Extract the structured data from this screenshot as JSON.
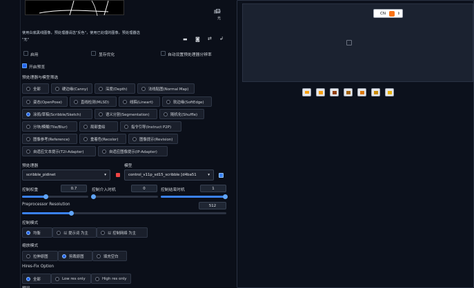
{
  "preview": {
    "buttons": [
      "翻转",
      "光"
    ]
  },
  "hint": {
    "line1": "使用白底黑线图像，预处理器请选\"反色\"，使用已处理的图像，预处理器选",
    "line2": "\"无\""
  },
  "checkboxes": [
    {
      "label": "启用",
      "checked": false
    },
    {
      "label": "显存优化",
      "checked": false
    },
    {
      "label": "自动设置预处理器分辨率",
      "checked": false
    },
    {
      "label": "开启预览",
      "checked": true
    }
  ],
  "filter": {
    "title": "预处理器与模型筛选",
    "items": [
      {
        "label": "全部",
        "selected": false
      },
      {
        "label": "硬边缘(Canny)",
        "selected": false
      },
      {
        "label": "深度(Depth)",
        "selected": false
      },
      {
        "label": "法线贴图(Normal Map)",
        "selected": false
      },
      {
        "label": "姿态(OpenPose)",
        "selected": false
      },
      {
        "label": "直线检测(MLSD)",
        "selected": false
      },
      {
        "label": "线稿(Lineart)",
        "selected": false
      },
      {
        "label": "软边缘(SoftEdge)",
        "selected": false
      },
      {
        "label": "涂鸦/草稿(Scribble/Sketch)",
        "selected": true
      },
      {
        "label": "语义分割(Segmentation)",
        "selected": false
      },
      {
        "label": "随机化(Shuffle)",
        "selected": false
      },
      {
        "label": "分块/模糊(Tile/Blur)",
        "selected": false
      },
      {
        "label": "局部重绘",
        "selected": false
      },
      {
        "label": "指令引导(Instruct P2P)",
        "selected": false
      },
      {
        "label": "图像参考(Reference)",
        "selected": false
      },
      {
        "label": "重着色(Recolor)",
        "selected": false
      },
      {
        "label": "图像提示(Revision)",
        "selected": false
      },
      {
        "label": "自适应文本提示(T2I-Adapter)",
        "selected": false
      },
      {
        "label": "自适应图像提示(IP-Adapter)",
        "selected": false
      }
    ]
  },
  "preprocessor": {
    "label": "预处理器",
    "value": "scribble_pidinet"
  },
  "model": {
    "label": "模型",
    "value": "control_v11p_sd15_scribble [d4ba51"
  },
  "sliders": {
    "weight": {
      "label": "控制权重",
      "value": "0.7",
      "fraction": 0.35
    },
    "start": {
      "label": "控制介入时机",
      "value": "0",
      "fraction": 0.0
    },
    "end": {
      "label": "控制结束时机",
      "value": "1",
      "fraction": 1.0
    },
    "resolution": {
      "label": "Preprocessor Resolution",
      "value": "512",
      "fraction": 0.24
    }
  },
  "control_mode": {
    "title": "控制模式",
    "options": [
      {
        "label": "均衡",
        "selected": true
      },
      {
        "label": "以 提示词 为主",
        "selected": false
      },
      {
        "label": "以 控制网络 为主",
        "selected": false
      }
    ]
  },
  "resize_mode": {
    "title": "缩放模式",
    "options": [
      {
        "label": "拉伸原图",
        "selected": false
      },
      {
        "label": "剪裁原图",
        "selected": true
      },
      {
        "label": "填充空白",
        "selected": false
      }
    ]
  },
  "hires": {
    "title": "Hires-Fix Option",
    "options": [
      {
        "label": "全部",
        "selected": true
      },
      {
        "label": "Low res only",
        "selected": false
      },
      {
        "label": "High res only",
        "selected": false
      }
    ]
  },
  "bottom_label": "预设",
  "lang_select": {
    "value": "CN"
  },
  "colors": {
    "accent": "#2563eb",
    "background": "#0b0f19",
    "panel_border": "#2a3243"
  }
}
